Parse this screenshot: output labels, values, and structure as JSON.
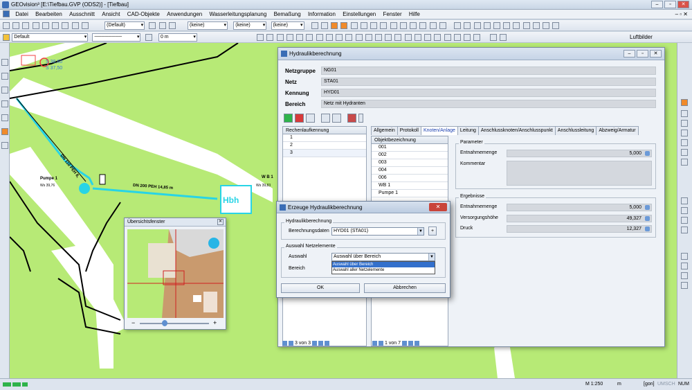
{
  "app": {
    "title": "GEOvision³ [E:\\Tiefbau.GVP (ODS2)] - [Tiefbau]"
  },
  "menu": [
    "Datei",
    "Bearbeiten",
    "Ausschnitt",
    "Ansicht",
    "CAD-Objekte",
    "Anwendungen",
    "Wasserleitungsplanung",
    "Bemaßung",
    "Information",
    "Einstellungen",
    "Fenster",
    "Hilfe"
  ],
  "toolbar1": {
    "combo1": "(Default)",
    "combo2": "(keine)",
    "combo3": "(keine)",
    "combo4": "(keine)"
  },
  "toolbar2": {
    "layer": "Default",
    "measure": "0 m",
    "luftbilder": "Luftbilder"
  },
  "map": {
    "labels": {
      "pumpe": "Pumpe 1",
      "pumpe_ws": "Ws 39,76",
      "wb": "W B 1",
      "wb_ws": "Ws 39,83",
      "pipe1": "DN 200 PEH 14,85 m",
      "pipe2": "DN 110 PEH 8,",
      "hbh": "Hbh",
      "top1": "S 38,60",
      "top2": "S 37,50"
    }
  },
  "hydraulik": {
    "title": "Hydraulikberechnung",
    "fields": [
      {
        "label": "Netzgruppe",
        "value": "NG01"
      },
      {
        "label": "Netz",
        "value": "STA01"
      },
      {
        "label": "Kennung",
        "value": "HYD01"
      },
      {
        "label": "Bereich",
        "value": "Netz mit Hydranten"
      }
    ],
    "left_grid": {
      "header": "Rechenlaufkennung",
      "rows": [
        "1",
        "2",
        "3"
      ]
    },
    "tabs": [
      "Allgemein",
      "Protokoll",
      "Knoten/Anlage",
      "Leitung",
      "Anschlussknoten/Anschlusspunkt",
      "Anschlussleitung",
      "Abzweig/Armatur"
    ],
    "active_tab": "Knoten/Anlage",
    "obj_grid": {
      "header": "Objektbezeichnung",
      "rows": [
        "001",
        "002",
        "003",
        "004",
        "006",
        "WB 1",
        "Pumpe 1"
      ]
    },
    "parameter": {
      "group": "Parameter",
      "entnahme_label": "Entnahmemenge",
      "entnahme_value": "5,000",
      "kommentar_label": "Kommentar"
    },
    "ergebnisse": {
      "group": "Ergebnisse",
      "entnahme_label": "Entnahmemenge",
      "entnahme_value": "5,000",
      "versorgung_label": "Versorgungshöhe",
      "versorgung_value": "49,327",
      "druck_label": "Druck",
      "druck_value": "12,327"
    },
    "nav_left": "3 von 3",
    "nav_right": "1 von 7"
  },
  "dialog": {
    "title": "Erzeuge Hydraulikberechnung",
    "group1": "Hydraulikberechnung",
    "berechnungsdaten_label": "Berechnungsdaten",
    "berechnungsdaten_value": "HYD01 (STA01)",
    "group2": "Auswahl Netzelemente",
    "auswahl_label": "Auswahl",
    "auswahl_value": "Auswahl über Bereich",
    "bereich_label": "Bereich",
    "options": [
      "Auswahl über Bereich",
      "Auswahl aller Netzelemente"
    ],
    "ok": "OK",
    "cancel": "Abbrechen"
  },
  "overview": {
    "title": "Übersichtsfenster"
  },
  "status": {
    "scale": "M 1:250",
    "unit": "m",
    "gon": "[gon]",
    "umsch": "UMSCH",
    "num": "NUM"
  }
}
